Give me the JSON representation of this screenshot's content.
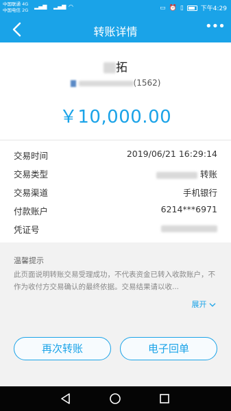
{
  "status_bar": {
    "carrier_1": "中国联通",
    "carrier_1_net": "4G",
    "carrier_2": "中国电信",
    "carrier_2_net": "2G",
    "time": "下午4:29"
  },
  "header": {
    "title": "转账详情",
    "more_label": "•••",
    "back_icon": "chevron-left-icon"
  },
  "payee": {
    "name_visible": "拓",
    "account_suffix": "(1562)"
  },
  "amount": "￥10,000.00",
  "details": [
    {
      "label": "交易时间",
      "value": "2019/06/21  16:29:14"
    },
    {
      "label": "交易类型",
      "value": "转账"
    },
    {
      "label": "交易渠道",
      "value": "手机银行"
    },
    {
      "label": "付款账户",
      "value": "6214***6971"
    },
    {
      "label": "凭证号",
      "value": ""
    }
  ],
  "tips": {
    "title": "温馨提示",
    "body": "此页面说明转账交易受理成功，不代表资金已转入收款账户，不作为收付方交易确认的最终依据。交易结果请以收...",
    "expand_label": "展开"
  },
  "actions": {
    "transfer_again": "再次转账",
    "e_receipt": "电子回单"
  },
  "colors": {
    "accent": "#1aa3e8",
    "nav_bg": "#050505"
  }
}
